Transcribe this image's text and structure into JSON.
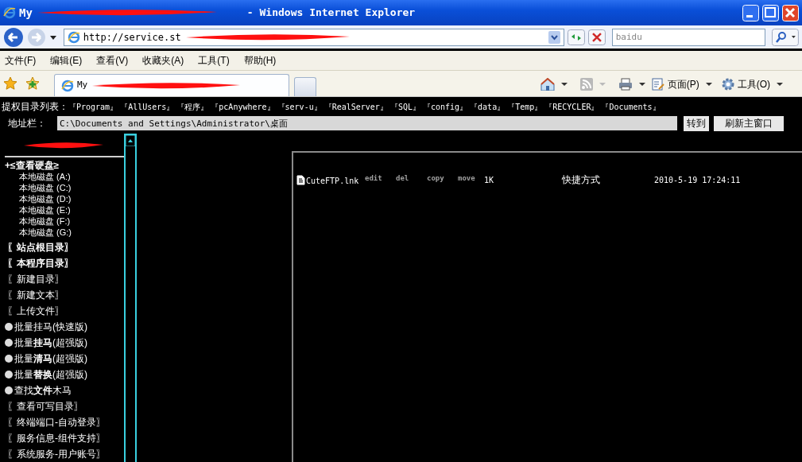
{
  "window": {
    "title_start": "My",
    "title_end": "- Windows Internet Explorer"
  },
  "navbar": {
    "address": "http://service.st",
    "search_placeholder": "baidu"
  },
  "menu": [
    "文件(F)",
    "编辑(E)",
    "查看(V)",
    "收藏夹(A)",
    "工具(T)",
    "帮助(H)"
  ],
  "tabs": [
    {
      "label": "My",
      "selected": true
    }
  ],
  "command_bar": {
    "page": "页面(P)",
    "tools": "工具(O)"
  },
  "shortcuts": {
    "label": "提权目录列表：",
    "items": [
      "『Program』",
      "『AllUsers』",
      "『程序』",
      "『pcAnywhere』",
      "『serv-u』",
      "『RealServer』",
      "『SQL』",
      "『config』",
      "『data』",
      "『Temp』",
      "『RECYCLER』",
      "『Documents』"
    ]
  },
  "path_bar": {
    "label": "地址栏：",
    "value": "C:\\Documents and Settings\\Administrator\\桌面",
    "go": "转到",
    "refresh": "刷新主窗口"
  },
  "sidebar": {
    "disks_title": "+≤查看硬盘≥",
    "disks": [
      "本地磁盘 (A:)",
      "本地磁盘 (C:)",
      "本地磁盘 (D:)",
      "本地磁盘 (E:)",
      "本地磁盘 (F:)",
      "本地磁盘 (G:)"
    ],
    "items": [
      {
        "kind": "bold",
        "label": "〖站点根目录〗"
      },
      {
        "kind": "bold",
        "label": "〖本程序目录〗"
      },
      {
        "kind": "plain",
        "label": "〖新建目录〗"
      },
      {
        "kind": "plain",
        "label": "〖新建文本〗"
      },
      {
        "kind": "plain",
        "label": "〖上传文件〗"
      },
      {
        "kind": "bullet",
        "label": "批量挂马(快速版)"
      },
      {
        "kind": "bullet",
        "label": "批量**挂马**(超强版)"
      },
      {
        "kind": "bullet",
        "label": "批量**清马**(超强版)"
      },
      {
        "kind": "bullet",
        "label": "批量**替换**(超强版)"
      },
      {
        "kind": "bullet",
        "label": "查找**文件**木马"
      },
      {
        "kind": "plain",
        "label": "〖查看可写目录〗"
      },
      {
        "kind": "plain",
        "label": "〖终端端口-自动登录〗"
      },
      {
        "kind": "plain",
        "label": "〖服务信息-组件支持〗"
      },
      {
        "kind": "plain",
        "label": "〖系统服务-用户账号〗"
      }
    ]
  },
  "files": [
    {
      "name": "CuteFTP.lnk",
      "actions": [
        "edit",
        "del",
        "copy",
        "move"
      ],
      "size": "1K",
      "type": "快捷方式",
      "modified": "2010-5-19 17:24:11"
    }
  ]
}
